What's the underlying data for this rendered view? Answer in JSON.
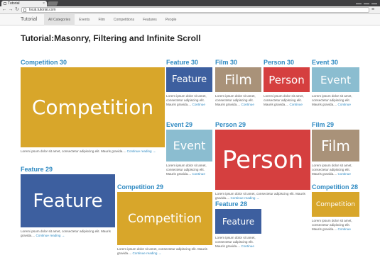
{
  "browser": {
    "tab_title": "Tutorial",
    "tab_close": "×",
    "url": "local.tutorial.com",
    "back": "←",
    "forward": "→",
    "reload": "↻",
    "menu": "≡"
  },
  "navbar": {
    "brand": "Tutorial",
    "items": [
      "All Categories",
      "Events",
      "Film",
      "Competitions",
      "Features",
      "People"
    ]
  },
  "page_title": "Tutorial:Masonry, Filtering and Infinite Scroll",
  "excerpt": "Lorem ipsum dolor sit amet, consectetur adipiscing elit. Mauris gravida....",
  "continue_label": "Continue reading →",
  "colors": {
    "competition": "#d8a62a",
    "feature": "#3d5f9f",
    "film": "#a99279",
    "person": "#d53f3f",
    "event": "#8bbdd0",
    "link": "#2f8ac2"
  },
  "posts": [
    {
      "title": "Competition 30",
      "image_text": "Competition",
      "category": "competition"
    },
    {
      "title": "Feature 30",
      "image_text": "Feature",
      "category": "feature"
    },
    {
      "title": "Film 30",
      "image_text": "Film",
      "category": "film"
    },
    {
      "title": "Person 30",
      "image_text": "Person",
      "category": "person"
    },
    {
      "title": "Event 30",
      "image_text": "Event",
      "category": "event"
    },
    {
      "title": "Event 29",
      "image_text": "Event",
      "category": "event"
    },
    {
      "title": "Person 29",
      "image_text": "Person",
      "category": "person"
    },
    {
      "title": "Film 29",
      "image_text": "Film",
      "category": "film"
    },
    {
      "title": "Feature 29",
      "image_text": "Feature",
      "category": "feature"
    },
    {
      "title": "Competition 29",
      "image_text": "Competition",
      "category": "competition"
    },
    {
      "title": "Feature 28",
      "image_text": "Feature",
      "category": "feature"
    },
    {
      "title": "Competition 28",
      "image_text": "Competition",
      "category": "competition"
    }
  ]
}
